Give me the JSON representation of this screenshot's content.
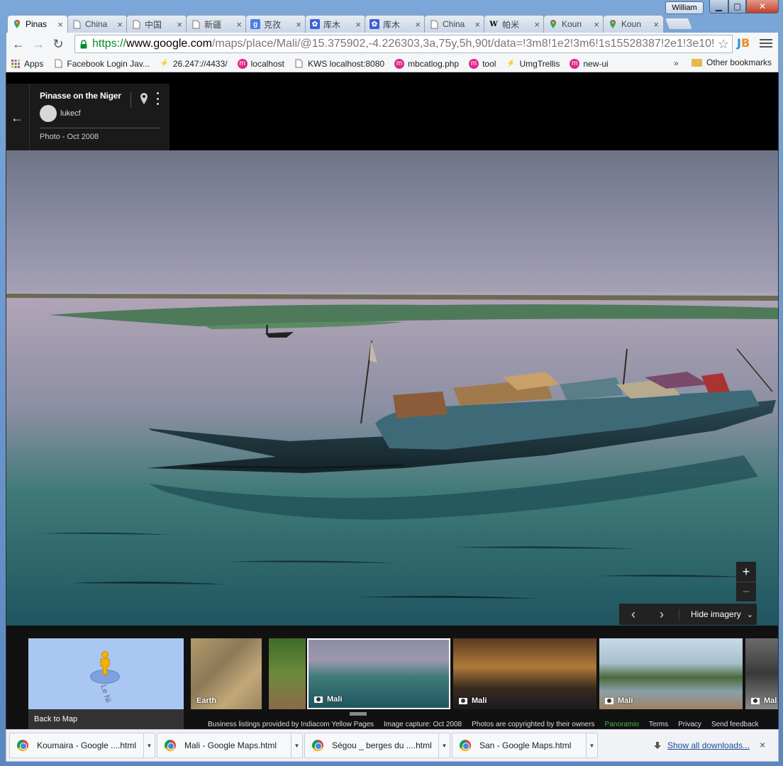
{
  "window": {
    "user": "William"
  },
  "tabs": [
    {
      "label": "Pinas",
      "icon": "google-maps-icon",
      "active": true
    },
    {
      "label": "China",
      "icon": "page-icon"
    },
    {
      "label": "中国",
      "icon": "page-icon"
    },
    {
      "label": "新疆",
      "icon": "page-icon"
    },
    {
      "label": "克孜",
      "icon": "google-translate-icon"
    },
    {
      "label": "库木",
      "icon": "baidu-icon"
    },
    {
      "label": "库木",
      "icon": "baidu-icon"
    },
    {
      "label": "China",
      "icon": "page-icon"
    },
    {
      "label": "帕米",
      "icon": "wikipedia-icon"
    },
    {
      "label": "Koun",
      "icon": "google-maps-icon"
    },
    {
      "label": "Koun",
      "icon": "google-maps-icon"
    }
  ],
  "address": {
    "scheme": "https://",
    "host": "www.google.com",
    "path": "/maps/place/Mali/@15.375902,-4.226303,3a,75y,5h,90t/data=!3m8!1e2!3m6!1s15528387!2e1!3e10!"
  },
  "extension": {
    "j": "J",
    "b": "B"
  },
  "bookmarks": [
    {
      "label": "Apps",
      "icon": "apps-grid-icon"
    },
    {
      "label": "Facebook Login Jav...",
      "icon": "page-icon"
    },
    {
      "label": "26.247://4433/",
      "icon": "trellis-icon"
    },
    {
      "label": "localhost",
      "icon": "m-icon"
    },
    {
      "label": "KWS localhost:8080",
      "icon": "page-icon"
    },
    {
      "label": "mbcatlog.php",
      "icon": "m-icon"
    },
    {
      "label": "tool",
      "icon": "m-icon"
    },
    {
      "label": "UmgTrellis",
      "icon": "trellis-icon"
    },
    {
      "label": "new-ui",
      "icon": "m-icon"
    }
  ],
  "bookmarks_more": "»",
  "other_bookmarks": "Other bookmarks",
  "card": {
    "title": "Pinasse on the Niger",
    "author": "lukecf",
    "date": "Photo - Oct 2008"
  },
  "controls": {
    "zoom_in": "+",
    "zoom_out": "−",
    "prev": "‹",
    "next": "›",
    "hide_imagery": "Hide imagery",
    "chevron": "⌄"
  },
  "filmstrip": {
    "back_to_map": "Back to Map",
    "river_label": "Le Ni",
    "thumbs": [
      {
        "label": "Earth",
        "camera": false
      },
      {
        "label": "",
        "camera": false
      },
      {
        "label": "Mali",
        "camera": true,
        "selected": true
      },
      {
        "label": "Mali",
        "camera": true
      },
      {
        "label": "Mali",
        "camera": true
      },
      {
        "label": "Mal",
        "camera": true
      }
    ]
  },
  "attribution": {
    "listings": "Business listings provided by Indiacom Yellow Pages",
    "capture": "Image capture: Oct 2008",
    "copyright": "Photos are copyrighted by their owners",
    "panoramio": "Panoramio",
    "terms": "Terms",
    "privacy": "Privacy",
    "feedback": "Send feedback"
  },
  "downloads": {
    "items": [
      "Koumaira - Google ....html",
      "Mali - Google Maps.html",
      "Ségou _ berges du ....html",
      "San - Google Maps.html"
    ],
    "show_all": "Show all downloads...",
    "close": "×"
  }
}
